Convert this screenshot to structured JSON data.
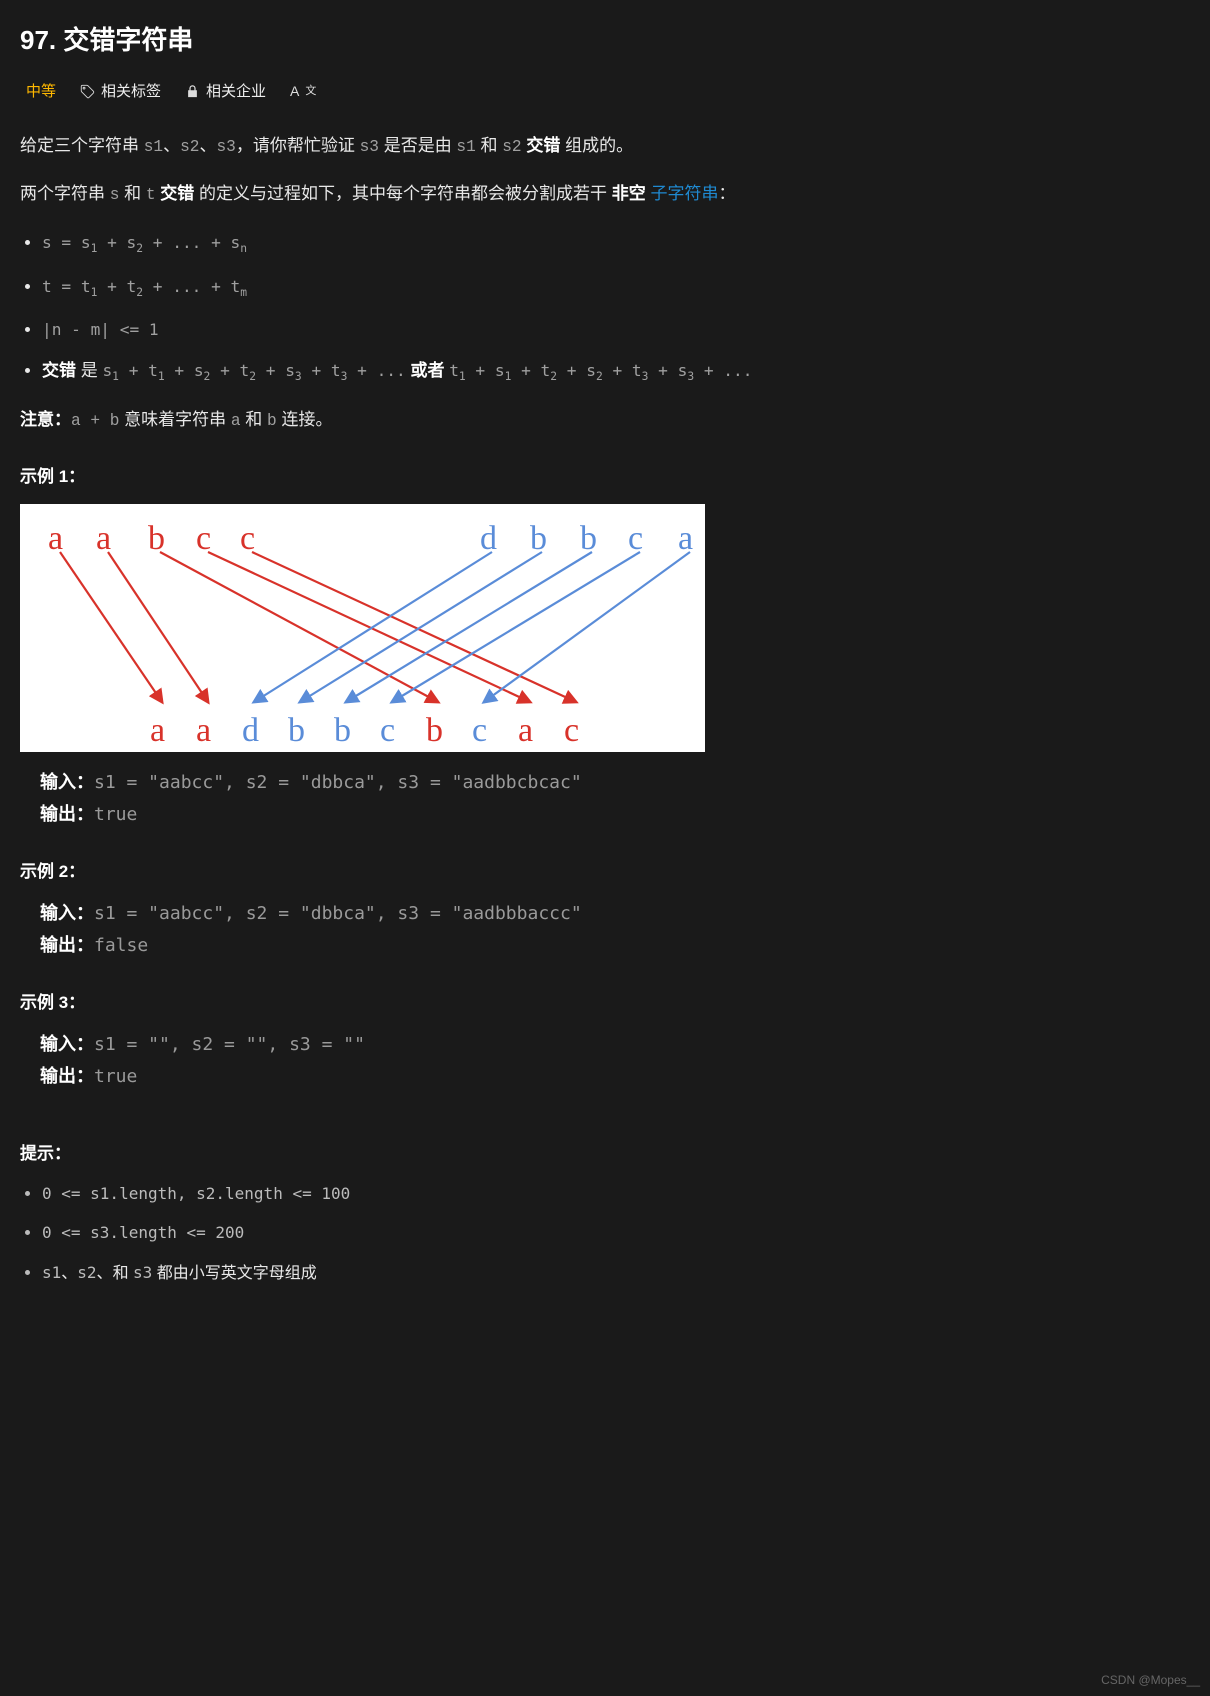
{
  "title": "97. 交错字符串",
  "meta": {
    "difficulty": "中等",
    "tags_label": "相关标签",
    "companies_label": "相关企业"
  },
  "intro": {
    "p1_pre": "给定三个字符串 ",
    "s1": "s1",
    "sep": "、",
    "s2": "s2",
    "s3": "s3",
    "p1_mid": "，请你帮忙验证 ",
    "p1_mid2": " 是否是由 ",
    "p1_and": " 和 ",
    "interleave": " 交错 ",
    "p1_end": "组成的。",
    "p2_pre": "两个字符串 ",
    "s": "s",
    "p2_and": " 和 ",
    "t": "t",
    "p2_def": " 的定义与过程如下，其中每个字符串都会被分割成若干 ",
    "nonempty": "非空",
    "substr": " 子字符串",
    "colon": "："
  },
  "bullets": {
    "b1": "s = s₁ + s₂ + ... + sₙ",
    "b2": "t = t₁ + t₂ + ... + tₘ",
    "b3": "|n - m| <= 1",
    "b4_pre": "交错",
    "b4_is": " 是 ",
    "b4_a": "s₁ + t₁ + s₂ + t₂ + s₃ + t₃ + ...",
    "b4_or": " 或者 ",
    "b4_b": "t₁ + s₁ + t₂ + s₂ + t₃ + s₃ + ..."
  },
  "note": {
    "label": "注意：",
    "expr": "a + b",
    "text1": " 意味着字符串 ",
    "a": "a",
    "and": " 和 ",
    "b": "b",
    "text2": " 连接。"
  },
  "examples": {
    "label1": "示例 1：",
    "label2": "示例 2：",
    "label3": "示例 3：",
    "input_label": "输入：",
    "output_label": "输出：",
    "e1_in": "s1 = \"aabcc\", s2 = \"dbbca\", s3 = \"aadbbcbcac\"",
    "e1_out": "true",
    "e2_in": "s1 = \"aabcc\", s2 = \"dbbca\", s3 = \"aadbbbaccc\"",
    "e2_out": "false",
    "e3_in": "s1 = \"\", s2 = \"\", s3 = \"\"",
    "e3_out": "true"
  },
  "diagram": {
    "top_s1": [
      "a",
      "a",
      "b",
      "c",
      "c"
    ],
    "top_s2": [
      "d",
      "b",
      "b",
      "c",
      "a"
    ],
    "bottom": [
      {
        "ch": "a",
        "c": "red"
      },
      {
        "ch": "a",
        "c": "red"
      },
      {
        "ch": "d",
        "c": "blue"
      },
      {
        "ch": "b",
        "c": "blue"
      },
      {
        "ch": "b",
        "c": "blue"
      },
      {
        "ch": "c",
        "c": "blue"
      },
      {
        "ch": "b",
        "c": "red"
      },
      {
        "ch": "c",
        "c": "blue"
      },
      {
        "ch": "a",
        "c": "red"
      },
      {
        "ch": "c",
        "c": "red"
      }
    ]
  },
  "hints": {
    "label": "提示：",
    "h1": "0 <= s1.length, s2.length <= 100",
    "h2": "0 <= s3.length <= 200",
    "h3_codes": [
      "s1",
      "s2"
    ],
    "h3_sep": "、",
    "h3_and": "和 ",
    "h3_code3": "s3",
    "h3_tail": " 都由小写英文字母组成"
  },
  "watermark": "CSDN @Mopes__"
}
